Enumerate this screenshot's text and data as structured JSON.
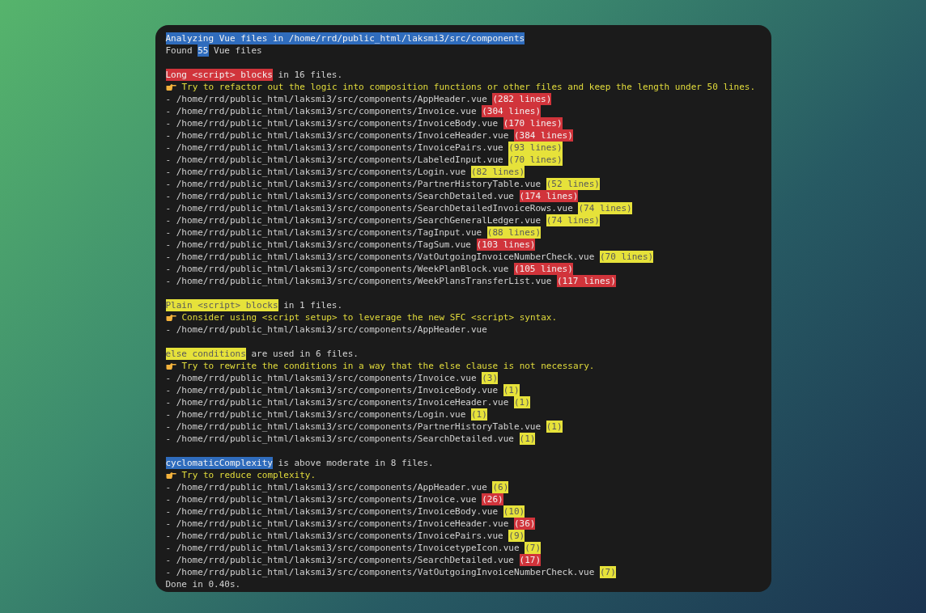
{
  "terminal": {
    "lines": [
      {
        "kind": "plain",
        "segments": [
          {
            "text": "Analyzing Vue files in /home/rrd/public_html/laksmi3/src/components",
            "color": "#2f6cbd"
          }
        ]
      },
      {
        "kind": "plain",
        "segments": [
          {
            "text": "Found "
          },
          {
            "text": "55",
            "color": "#2f6cbd"
          },
          {
            "text": " Vue files"
          }
        ]
      },
      {
        "kind": "blank"
      },
      {
        "kind": "plain",
        "segments": [
          {
            "text": "Long <script> blocks",
            "color": "#d1343b"
          },
          {
            "text": " in 16 files."
          }
        ]
      },
      {
        "kind": "tip",
        "segments": [
          {
            "text": "Try to refactor out the logic into composition functions or other files and keep the length under 50 lines."
          }
        ]
      },
      {
        "kind": "plain",
        "segments": [
          {
            "text": "- /home/rrd/public_html/laksmi3/src/components/AppHeader.vue "
          },
          {
            "text": "(282 lines)",
            "color": "#d1343b"
          }
        ]
      },
      {
        "kind": "plain",
        "segments": [
          {
            "text": "- /home/rrd/public_html/laksmi3/src/components/Invoice.vue "
          },
          {
            "text": "(304 lines)",
            "color": "#d1343b"
          }
        ]
      },
      {
        "kind": "plain",
        "segments": [
          {
            "text": "- /home/rrd/public_html/laksmi3/src/components/InvoiceBody.vue "
          },
          {
            "text": "(170 lines)",
            "color": "#d1343b"
          }
        ]
      },
      {
        "kind": "plain",
        "segments": [
          {
            "text": "- /home/rrd/public_html/laksmi3/src/components/InvoiceHeader.vue "
          },
          {
            "text": "(384 lines)",
            "color": "#d1343b"
          }
        ]
      },
      {
        "kind": "plain",
        "segments": [
          {
            "text": "- /home/rrd/public_html/laksmi3/src/components/InvoicePairs.vue "
          },
          {
            "text": "(93 lines)",
            "color": "#e6e23a"
          }
        ]
      },
      {
        "kind": "plain",
        "segments": [
          {
            "text": "- /home/rrd/public_html/laksmi3/src/components/LabeledInput.vue "
          },
          {
            "text": "(70 lines)",
            "color": "#e6e23a"
          }
        ]
      },
      {
        "kind": "plain",
        "segments": [
          {
            "text": "- /home/rrd/public_html/laksmi3/src/components/Login.vue "
          },
          {
            "text": "(82 lines)",
            "color": "#e6e23a"
          }
        ]
      },
      {
        "kind": "plain",
        "segments": [
          {
            "text": "- /home/rrd/public_html/laksmi3/src/components/PartnerHistoryTable.vue "
          },
          {
            "text": "(52 lines)",
            "color": "#e6e23a"
          }
        ]
      },
      {
        "kind": "plain",
        "segments": [
          {
            "text": "- /home/rrd/public_html/laksmi3/src/components/SearchDetailed.vue "
          },
          {
            "text": "(174 lines)",
            "color": "#d1343b"
          }
        ]
      },
      {
        "kind": "plain",
        "segments": [
          {
            "text": "- /home/rrd/public_html/laksmi3/src/components/SearchDetailedInvoiceRows.vue "
          },
          {
            "text": "(74 lines)",
            "color": "#e6e23a"
          }
        ]
      },
      {
        "kind": "plain",
        "segments": [
          {
            "text": "- /home/rrd/public_html/laksmi3/src/components/SearchGeneralLedger.vue "
          },
          {
            "text": "(74 lines)",
            "color": "#e6e23a"
          }
        ]
      },
      {
        "kind": "plain",
        "segments": [
          {
            "text": "- /home/rrd/public_html/laksmi3/src/components/TagInput.vue "
          },
          {
            "text": "(88 lines)",
            "color": "#e6e23a"
          }
        ]
      },
      {
        "kind": "plain",
        "segments": [
          {
            "text": "- /home/rrd/public_html/laksmi3/src/components/TagSum.vue "
          },
          {
            "text": "(103 lines)",
            "color": "#d1343b"
          }
        ]
      },
      {
        "kind": "plain",
        "segments": [
          {
            "text": "- /home/rrd/public_html/laksmi3/src/components/VatOutgoingInvoiceNumberCheck.vue "
          },
          {
            "text": "(70 lines)",
            "color": "#e6e23a"
          }
        ]
      },
      {
        "kind": "plain",
        "segments": [
          {
            "text": "- /home/rrd/public_html/laksmi3/src/components/WeekPlanBlock.vue "
          },
          {
            "text": "(105 lines)",
            "color": "#d1343b"
          }
        ]
      },
      {
        "kind": "plain",
        "segments": [
          {
            "text": "- /home/rrd/public_html/laksmi3/src/components/WeekPlansTransferList.vue "
          },
          {
            "text": "(117 lines)",
            "color": "#d1343b"
          }
        ]
      },
      {
        "kind": "blank"
      },
      {
        "kind": "plain",
        "segments": [
          {
            "text": "Plain <script> blocks",
            "color": "#e6e23a"
          },
          {
            "text": " in 1 files."
          }
        ]
      },
      {
        "kind": "tip",
        "segments": [
          {
            "text": "Consider using <script setup> to leverage the new SFC <script> syntax."
          }
        ]
      },
      {
        "kind": "plain",
        "segments": [
          {
            "text": "- /home/rrd/public_html/laksmi3/src/components/AppHeader.vue"
          }
        ]
      },
      {
        "kind": "blank"
      },
      {
        "kind": "plain",
        "segments": [
          {
            "text": "else conditions",
            "color": "#e6e23a"
          },
          {
            "text": " are used in 6 files."
          }
        ]
      },
      {
        "kind": "tip",
        "segments": [
          {
            "text": "Try to rewrite the conditions in a way that the else clause is not necessary."
          }
        ]
      },
      {
        "kind": "plain",
        "segments": [
          {
            "text": "- /home/rrd/public_html/laksmi3/src/components/Invoice.vue "
          },
          {
            "text": "(3)",
            "color": "#e6e23a"
          }
        ]
      },
      {
        "kind": "plain",
        "segments": [
          {
            "text": "- /home/rrd/public_html/laksmi3/src/components/InvoiceBody.vue "
          },
          {
            "text": "(1)",
            "color": "#e6e23a"
          }
        ]
      },
      {
        "kind": "plain",
        "segments": [
          {
            "text": "- /home/rrd/public_html/laksmi3/src/components/InvoiceHeader.vue "
          },
          {
            "text": "(1)",
            "color": "#e6e23a"
          }
        ]
      },
      {
        "kind": "plain",
        "segments": [
          {
            "text": "- /home/rrd/public_html/laksmi3/src/components/Login.vue "
          },
          {
            "text": "(1)",
            "color": "#e6e23a"
          }
        ]
      },
      {
        "kind": "plain",
        "segments": [
          {
            "text": "- /home/rrd/public_html/laksmi3/src/components/PartnerHistoryTable.vue "
          },
          {
            "text": "(1)",
            "color": "#e6e23a"
          }
        ]
      },
      {
        "kind": "plain",
        "segments": [
          {
            "text": "- /home/rrd/public_html/laksmi3/src/components/SearchDetailed.vue "
          },
          {
            "text": "(1)",
            "color": "#e6e23a"
          }
        ]
      },
      {
        "kind": "blank"
      },
      {
        "kind": "plain",
        "segments": [
          {
            "text": "cyclomaticComplexity",
            "color": "#2f6cbd"
          },
          {
            "text": " is above moderate in 8 files."
          }
        ]
      },
      {
        "kind": "tip",
        "segments": [
          {
            "text": "Try to reduce complexity."
          }
        ]
      },
      {
        "kind": "plain",
        "segments": [
          {
            "text": "- /home/rrd/public_html/laksmi3/src/components/AppHeader.vue "
          },
          {
            "text": "(6)",
            "color": "#e6e23a"
          }
        ]
      },
      {
        "kind": "plain",
        "segments": [
          {
            "text": "- /home/rrd/public_html/laksmi3/src/components/Invoice.vue "
          },
          {
            "text": "(26)",
            "color": "#d1343b"
          }
        ]
      },
      {
        "kind": "plain",
        "segments": [
          {
            "text": "- /home/rrd/public_html/laksmi3/src/components/InvoiceBody.vue "
          },
          {
            "text": "(10)",
            "color": "#e6e23a"
          }
        ]
      },
      {
        "kind": "plain",
        "segments": [
          {
            "text": "- /home/rrd/public_html/laksmi3/src/components/InvoiceHeader.vue "
          },
          {
            "text": "(36)",
            "color": "#d1343b"
          }
        ]
      },
      {
        "kind": "plain",
        "segments": [
          {
            "text": "- /home/rrd/public_html/laksmi3/src/components/InvoicePairs.vue "
          },
          {
            "text": "(9)",
            "color": "#e6e23a"
          }
        ]
      },
      {
        "kind": "plain",
        "segments": [
          {
            "text": "- /home/rrd/public_html/laksmi3/src/components/InvoicetypeIcon.vue "
          },
          {
            "text": "(7)",
            "color": "#e6e23a"
          }
        ]
      },
      {
        "kind": "plain",
        "segments": [
          {
            "text": "- /home/rrd/public_html/laksmi3/src/components/SearchDetailed.vue "
          },
          {
            "text": "(17)",
            "color": "#d1343b"
          }
        ]
      },
      {
        "kind": "plain",
        "segments": [
          {
            "text": "- /home/rrd/public_html/laksmi3/src/components/VatOutgoingInvoiceNumberCheck.vue "
          },
          {
            "text": "(7)",
            "color": "#e6e23a"
          }
        ]
      },
      {
        "kind": "plain",
        "segments": [
          {
            "text": "Done in 0.40s."
          }
        ]
      }
    ]
  }
}
